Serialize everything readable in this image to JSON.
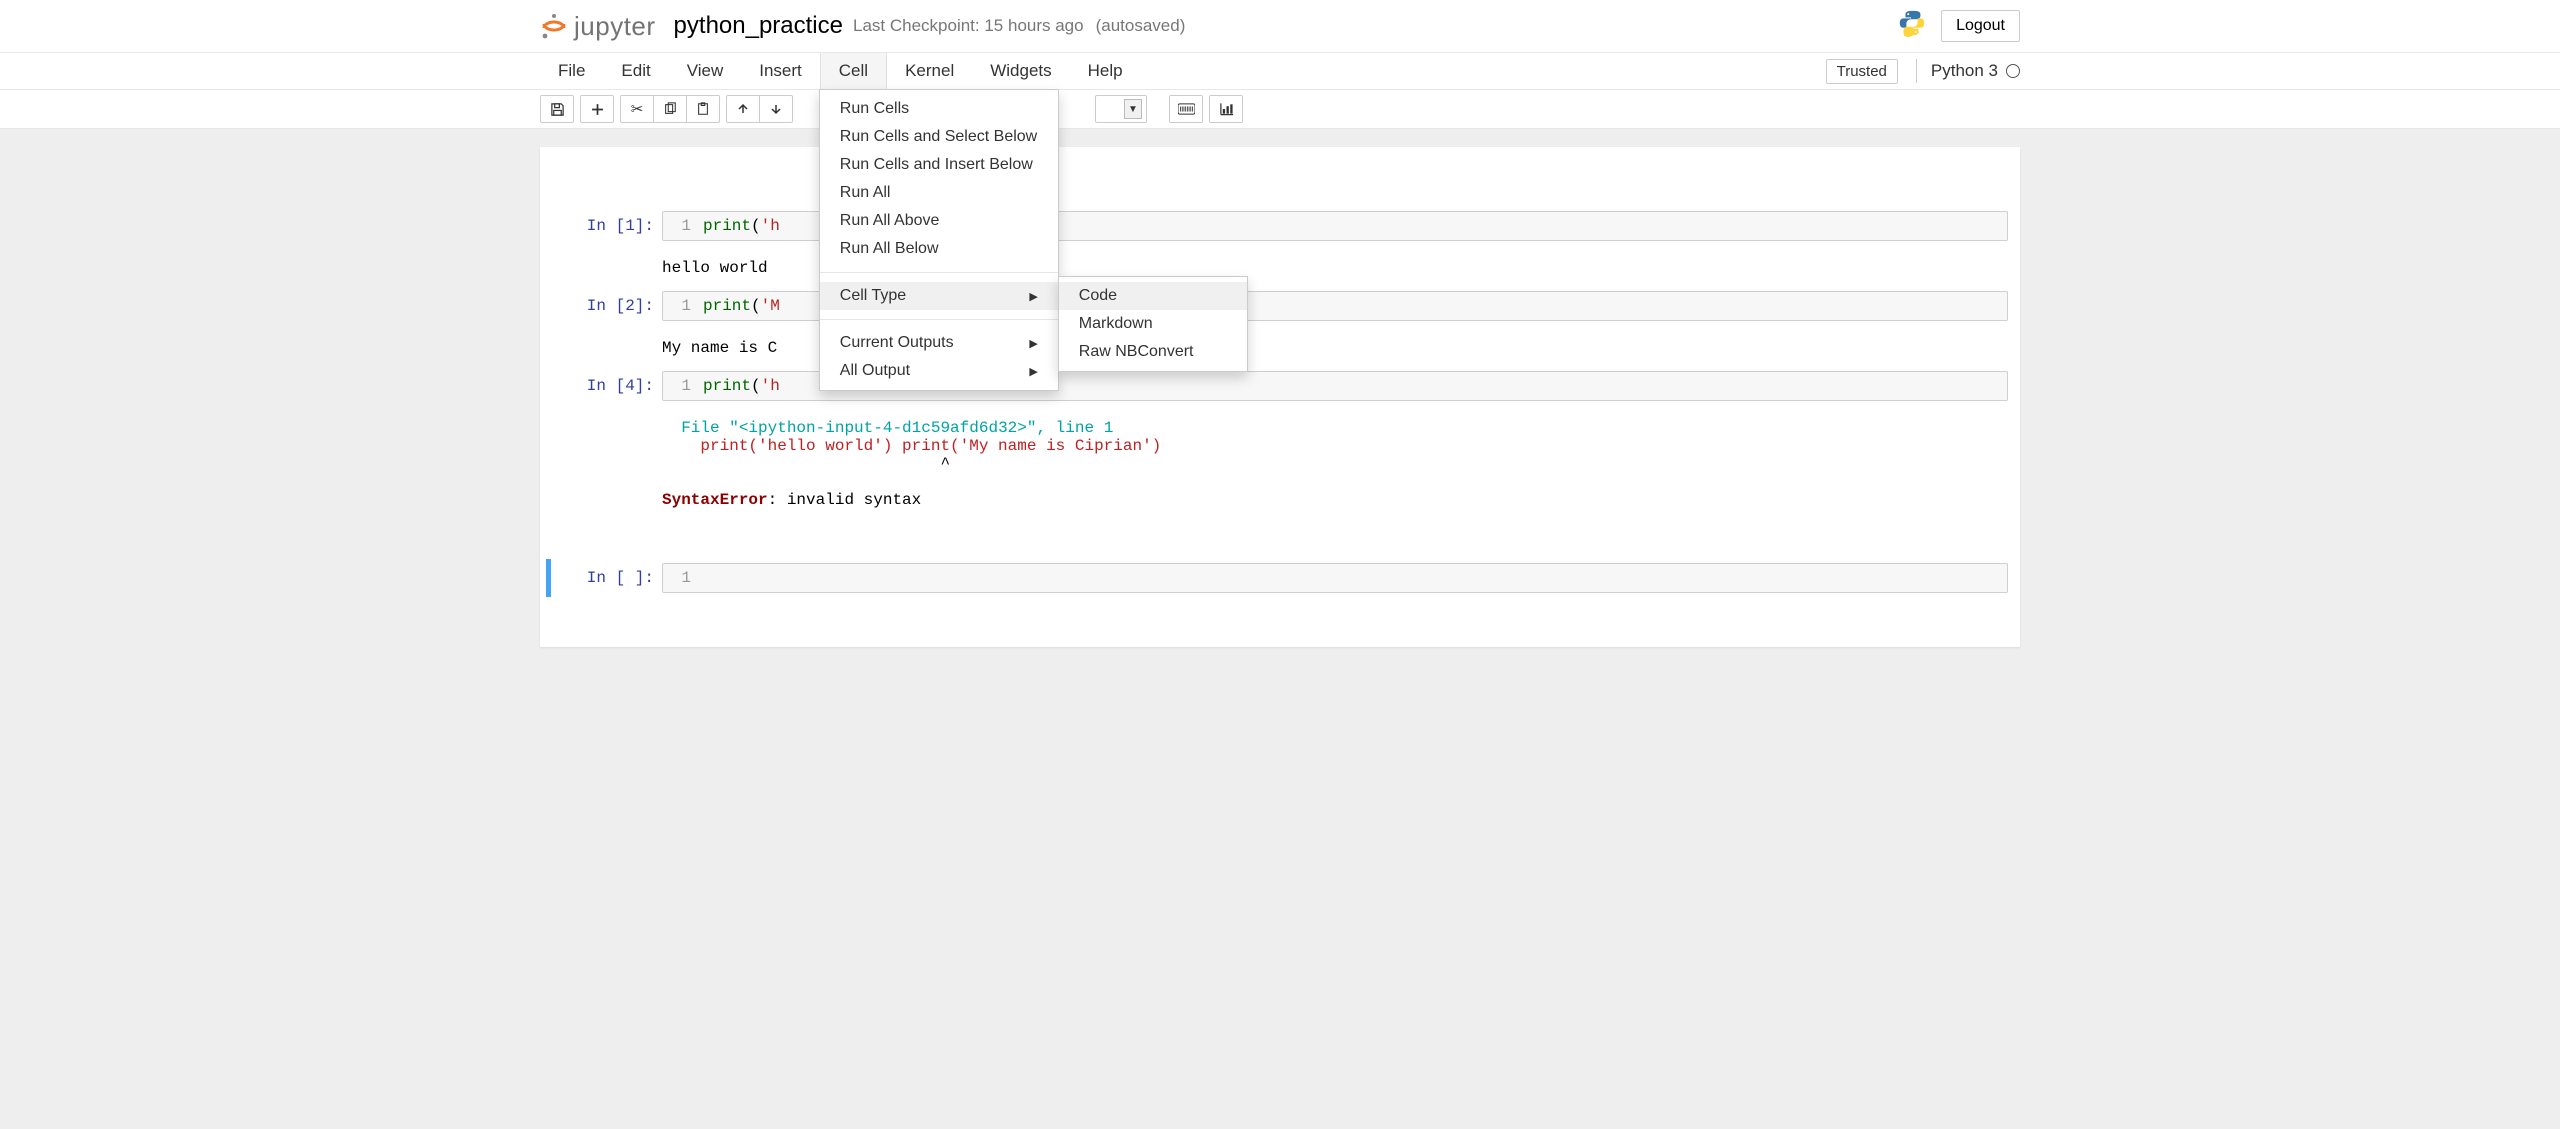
{
  "header": {
    "logo_text": "jupyter",
    "notebook_name": "python_practice",
    "checkpoint_text": "Last Checkpoint: 15 hours ago",
    "autosave_text": "(autosaved)",
    "logout_label": "Logout"
  },
  "menubar": {
    "items": [
      "File",
      "Edit",
      "View",
      "Insert",
      "Cell",
      "Kernel",
      "Widgets",
      "Help"
    ],
    "open_index": 4,
    "trusted_label": "Trusted",
    "kernel_label": "Python 3"
  },
  "cell_menu": {
    "items": [
      {
        "label": "Run Cells"
      },
      {
        "label": "Run Cells and Select Below"
      },
      {
        "label": "Run Cells and Insert Below"
      },
      {
        "label": "Run All"
      },
      {
        "label": "Run All Above"
      },
      {
        "label": "Run All Below"
      }
    ],
    "group2": [
      {
        "label": "Cell Type",
        "submenu": true,
        "highlight": true
      }
    ],
    "group3": [
      {
        "label": "Current Outputs",
        "submenu": true
      },
      {
        "label": "All Output",
        "submenu": true
      }
    ]
  },
  "celltype_submenu": {
    "items": [
      {
        "label": "Code",
        "highlight": true
      },
      {
        "label": "Markdown"
      },
      {
        "label": "Raw NBConvert"
      }
    ]
  },
  "cells": [
    {
      "prompt": "In [1]:",
      "line_no": "1",
      "code_builtin": "print",
      "code_paren_open": "(",
      "code_string_visible": "'h",
      "output": "hello world"
    },
    {
      "prompt": "In [2]:",
      "line_no": "1",
      "code_builtin": "print",
      "code_paren_open": "(",
      "code_string_visible": "'M",
      "output": "My name is C"
    },
    {
      "prompt": "In [4]:",
      "line_no": "1",
      "code_builtin": "print",
      "code_paren_open": "(",
      "code_string_visible": "'h",
      "error": {
        "file_label": "  File ",
        "file_value": "\"<ipython-input-4-d1c59afd6d32>\"",
        "line_sep": ", line ",
        "line_no": "1",
        "code_echo": "    print('hello world') print('My name is Ciprian')",
        "caret": "                             ^",
        "err_name": "SyntaxError",
        "err_sep": ": ",
        "err_msg": "invalid syntax"
      }
    },
    {
      "prompt": "In [ ]:",
      "line_no": "1",
      "selected": true
    }
  ]
}
